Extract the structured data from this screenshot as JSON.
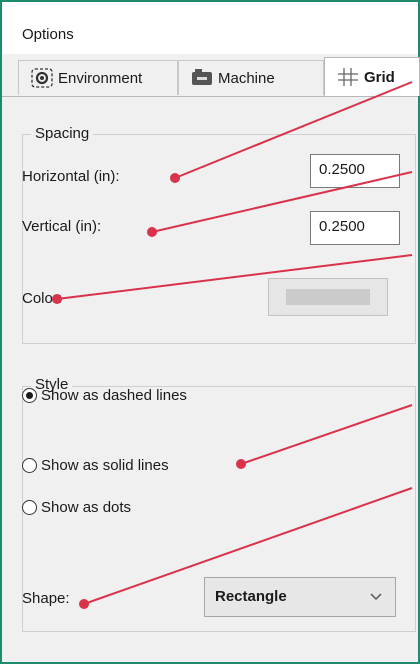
{
  "window": {
    "title": "Options"
  },
  "tabs": [
    {
      "label": "Environment",
      "icon": "gear-icon",
      "active": false
    },
    {
      "label": "Machine",
      "icon": "machine-icon",
      "active": false
    },
    {
      "label": "Grid",
      "icon": "grid-icon",
      "active": true
    }
  ],
  "spacing": {
    "group_label": "Spacing",
    "horizontal": {
      "label": "Horizontal (in):",
      "value": "0.2500"
    },
    "vertical": {
      "label": "Vertical (in):",
      "value": "0.2500"
    },
    "color": {
      "label": "Color:",
      "swatch": "#cbcbcb"
    }
  },
  "style": {
    "group_label": "Style",
    "options": [
      {
        "label": "Show as dashed lines",
        "checked": true
      },
      {
        "label": "Show as solid lines",
        "checked": false
      },
      {
        "label": "Show as dots",
        "checked": false
      }
    ],
    "shape": {
      "label": "Shape:",
      "value": "Rectangle"
    }
  },
  "colors": {
    "frame_border": "#1e8a6e",
    "callout": "#d9324a",
    "dialog_bg": "#f0f0f0"
  }
}
